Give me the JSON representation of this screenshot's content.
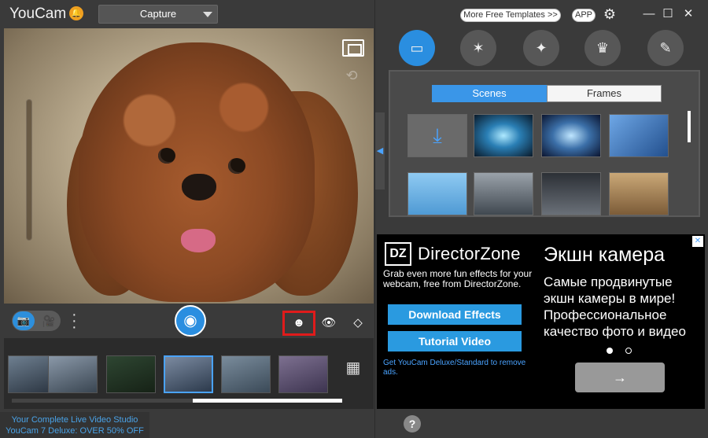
{
  "app": {
    "title": "YouCam",
    "mode": "Capture",
    "notification_icon": "bell-icon",
    "mode_caret_icon": "chevron-down-icon"
  },
  "capture_panel": {
    "fullscreen_icon": "fullscreen-icon",
    "rotate_icon": "rotate-camera-icon",
    "zoom_icon": "zoom-slider",
    "mode_toggle": {
      "photo_icon": "camera-icon",
      "video_icon": "video-camera-icon",
      "selected": "photo"
    },
    "more_icon": "vertical-dots-icon",
    "shutter_icon": "shutter-icon",
    "tools": [
      "face-icon",
      "eye-icon",
      "eraser-icon"
    ]
  },
  "gallery": {
    "grid_icon": "grid-icon",
    "thumbnails": [
      {
        "selected": false
      },
      {
        "selected": false
      },
      {
        "selected": false
      },
      {
        "selected": true
      },
      {
        "selected": false
      },
      {
        "selected": false
      }
    ]
  },
  "promo": {
    "line1": "Your Complete Live Video Studio",
    "line2": "YouCam 7 Deluxe: OVER 50% OFF"
  },
  "header_right": {
    "more_templates": "More Free Templates >>",
    "app_button": "APP",
    "settings_icon": "gear-icon",
    "minimize_icon": "minimize-icon",
    "maximize_icon": "maximize-icon",
    "close_icon": "close-icon",
    "minimize_glyph": "—",
    "maximize_glyph": "☐",
    "close_glyph": "✕"
  },
  "effect_tabs": [
    {
      "icon": "scenes-icon",
      "active": true
    },
    {
      "icon": "particle-icon",
      "active": false
    },
    {
      "icon": "magic-wand-icon",
      "active": false
    },
    {
      "icon": "avatar-icon",
      "active": false
    },
    {
      "icon": "brush-icon",
      "active": false
    }
  ],
  "effects_panel": {
    "tabs": [
      "Scenes",
      "Frames"
    ],
    "selected_tab": "Scenes",
    "download_icon": "download-icon"
  },
  "ad": {
    "brand": "DirectorZone",
    "logo_text": "DZ",
    "description": "Grab even more fun effects for your webcam, free from DirectorZone.",
    "download_button": "Download Effects",
    "tutorial_button": "Tutorial Video",
    "link": "Get YouCam Deluxe/Standard to remove ads.",
    "title": "Экшн камера",
    "body": "Самые продвинутые экшн камеры в мире! Профессиональное качество фото и видео",
    "next_glyph": "→"
  },
  "colors": {
    "accent": "#2a8ee0",
    "highlight_border": "#e01b1b",
    "link": "#4aa3ff",
    "panel_bg": "#3a3a3a"
  }
}
